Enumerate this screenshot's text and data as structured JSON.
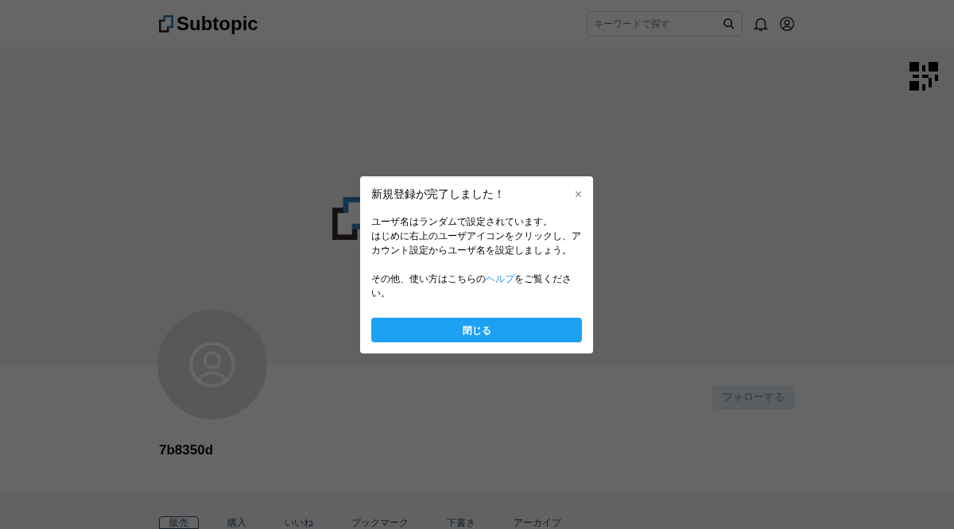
{
  "header": {
    "logo": "Subtopic",
    "search": {
      "placeholder": "キーワードで探す"
    }
  },
  "profile": {
    "username": "7b8350d",
    "follow_button": "フォローする"
  },
  "tabs": [
    {
      "label": "販売",
      "selected": true
    },
    {
      "label": "購入",
      "selected": false
    },
    {
      "label": "いいね",
      "selected": false
    },
    {
      "label": "ブックマーク",
      "selected": false
    },
    {
      "label": "下書き",
      "selected": false
    },
    {
      "label": "アーカイブ",
      "selected": false
    }
  ],
  "dialog": {
    "title": "新規登録が完了しました！",
    "close": "×",
    "paragraphs": [
      "ユーザ名はランダムで設定されています。",
      "はじめに右上のユーザアイコンをクリックし、アカウント設定からユーザ名を設定しましょう。"
    ],
    "help_before": "その他、使い方はこちらの",
    "help_link": "ヘルプ",
    "help_after": "をご覧ください。",
    "button": "閉じる"
  }
}
